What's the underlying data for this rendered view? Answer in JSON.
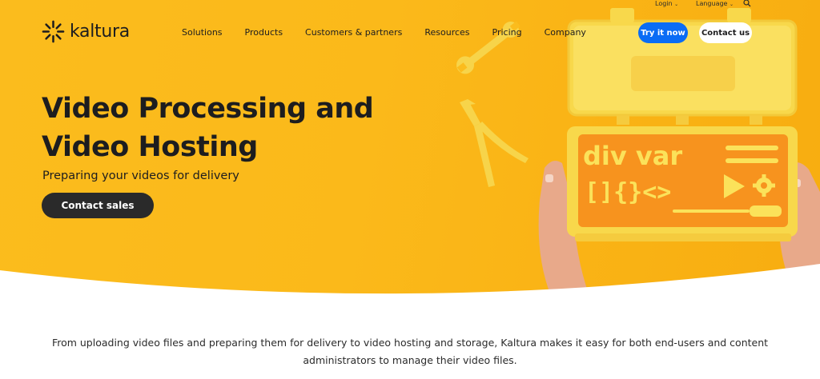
{
  "brand": {
    "name": "kaltura"
  },
  "utility": {
    "login": "Login",
    "language": "Language"
  },
  "nav": {
    "items": [
      {
        "label": "Solutions"
      },
      {
        "label": "Products"
      },
      {
        "label": "Customers & partners"
      },
      {
        "label": "Resources"
      },
      {
        "label": "Pricing"
      },
      {
        "label": "Company"
      }
    ],
    "try_label": "Try it now",
    "contact_label": "Contact us"
  },
  "hero": {
    "title_line1": "Video Processing and",
    "title_line2": "Video Hosting",
    "subtitle": "Preparing your videos for delivery",
    "cta": "Contact sales",
    "box_text": "div var",
    "box_symbols": "[]{}<>"
  },
  "intro": {
    "text": "From uploading video files and preparing them for delivery to video hosting and storage, Kaltura makes it easy for both end-users and content administrators to manage their video files."
  },
  "colors": {
    "hero_bg": "#fbbc1d",
    "primary_button": "#0a6cf5",
    "dark_button": "#2a2a2a",
    "box_orange": "#f7931e",
    "box_yellow": "#fbe25a"
  },
  "icons": [
    "kaltura-logo-icon",
    "chevron-down-icon",
    "search-icon",
    "wrench-icon",
    "pliers-icon",
    "play-icon",
    "gear-icon",
    "screwdriver-icon"
  ]
}
